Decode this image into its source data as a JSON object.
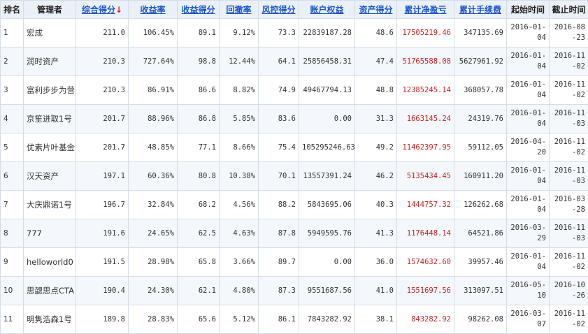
{
  "colors": {
    "header_bg": "#eaf0f7",
    "link": "#1a55c6",
    "sort_arrow": "#e02020",
    "pnl": "#cc2020",
    "border": "#d6dde6"
  },
  "table": {
    "headers": {
      "rank": "排名",
      "manager": "管理者",
      "composite": "综合得分",
      "composite_arrow": "↓",
      "return_rate": "收益率",
      "return_score": "收益得分",
      "drawdown": "回撤率",
      "risk_score": "风控得分",
      "equity": "账户权益",
      "asset_score": "资产得分",
      "cum_pnl": "累计净盈亏",
      "cum_fee": "累计手续费",
      "start": "起始时间",
      "end": "截止时间"
    },
    "rows": [
      {
        "rank": "1",
        "manager": "宏成",
        "composite": "211.0",
        "return_rate": "106.45%",
        "return_score": "89.1",
        "drawdown": "9.12%",
        "risk_score": "73.3",
        "equity": "22839187.28",
        "asset_score": "48.6",
        "cum_pnl": "17505219.46",
        "cum_fee": "347135.69",
        "start": "2016-01-04",
        "end": "2016-08-23"
      },
      {
        "rank": "2",
        "manager": "润时资产",
        "composite": "210.3",
        "return_rate": "727.64%",
        "return_score": "98.8",
        "drawdown": "12.44%",
        "risk_score": "64.1",
        "equity": "25856458.31",
        "asset_score": "47.4",
        "cum_pnl": "51765588.08",
        "cum_fee": "5627961.92",
        "start": "2016-01-04",
        "end": "2016-11-02"
      },
      {
        "rank": "3",
        "manager": "富利步步为营",
        "composite": "210.3",
        "return_rate": "86.91%",
        "return_score": "86.6",
        "drawdown": "8.82%",
        "risk_score": "74.9",
        "equity": "49467794.13",
        "asset_score": "48.8",
        "cum_pnl": "12385245.14",
        "cum_fee": "368057.78",
        "start": "2016-01-04",
        "end": "2016-11-02"
      },
      {
        "rank": "4",
        "manager": "京笙进取1号",
        "composite": "201.7",
        "return_rate": "88.96%",
        "return_score": "86.8",
        "drawdown": "5.85%",
        "risk_score": "83.6",
        "equity": "0.00",
        "asset_score": "31.3",
        "cum_pnl": "1663145.24",
        "cum_fee": "24319.76",
        "start": "2016-01-04",
        "end": "2016-11-03"
      },
      {
        "rank": "5",
        "manager": "优素片叶基金",
        "composite": "201.7",
        "return_rate": "48.85%",
        "return_score": "77.1",
        "drawdown": "8.66%",
        "risk_score": "75.4",
        "equity": "105295246.63",
        "asset_score": "49.2",
        "cum_pnl": "11462397.95",
        "cum_fee": "59112.05",
        "start": "2016-04-20",
        "end": "2016-11-02"
      },
      {
        "rank": "6",
        "manager": "汉天资产",
        "composite": "197.1",
        "return_rate": "60.36%",
        "return_score": "80.8",
        "drawdown": "10.38%",
        "risk_score": "70.1",
        "equity": "13557391.24",
        "asset_score": "46.2",
        "cum_pnl": "5135434.45",
        "cum_fee": "160911.20",
        "start": "2016-01-04",
        "end": "2016-11-03"
      },
      {
        "rank": "7",
        "manager": "大庆鼎诺1号",
        "composite": "196.7",
        "return_rate": "32.84%",
        "return_score": "68.2",
        "drawdown": "4.56%",
        "risk_score": "88.2",
        "equity": "5843695.06",
        "asset_score": "40.3",
        "cum_pnl": "1444757.32",
        "cum_fee": "126262.68",
        "start": "2016-01-04",
        "end": "2016-03-28"
      },
      {
        "rank": "8",
        "manager": "777",
        "composite": "191.6",
        "return_rate": "24.65%",
        "return_score": "62.5",
        "drawdown": "4.63%",
        "risk_score": "87.8",
        "equity": "5949595.76",
        "asset_score": "41.3",
        "cum_pnl": "1176448.14",
        "cum_fee": "64521.86",
        "start": "2016-03-29",
        "end": "2016-11-03"
      },
      {
        "rank": "9",
        "manager": "helloworld0",
        "composite": "191.5",
        "return_rate": "28.98%",
        "return_score": "65.8",
        "drawdown": "3.66%",
        "risk_score": "89.7",
        "equity": "0.00",
        "asset_score": "36.0",
        "cum_pnl": "1574632.60",
        "cum_fee": "39957.46",
        "start": "2016-01-04",
        "end": "2016-11-02"
      },
      {
        "rank": "10",
        "manager": "思勰思点CTA",
        "composite": "190.4",
        "return_rate": "24.30%",
        "return_score": "62.1",
        "drawdown": "4.80%",
        "risk_score": "87.3",
        "equity": "9551687.56",
        "asset_score": "41.0",
        "cum_pnl": "1551697.56",
        "cum_fee": "313097.51",
        "start": "2016-05-10",
        "end": "2016-10-26"
      },
      {
        "rank": "11",
        "manager": "明隽浩森1号",
        "composite": "189.8",
        "return_rate": "28.83%",
        "return_score": "65.6",
        "drawdown": "5.12%",
        "risk_score": "86.1",
        "equity": "7843282.92",
        "asset_score": "38.1",
        "cum_pnl": "843282.92",
        "cum_fee": "98262.08",
        "start": "2016-03-07",
        "end": "2016-11-02"
      }
    ]
  }
}
